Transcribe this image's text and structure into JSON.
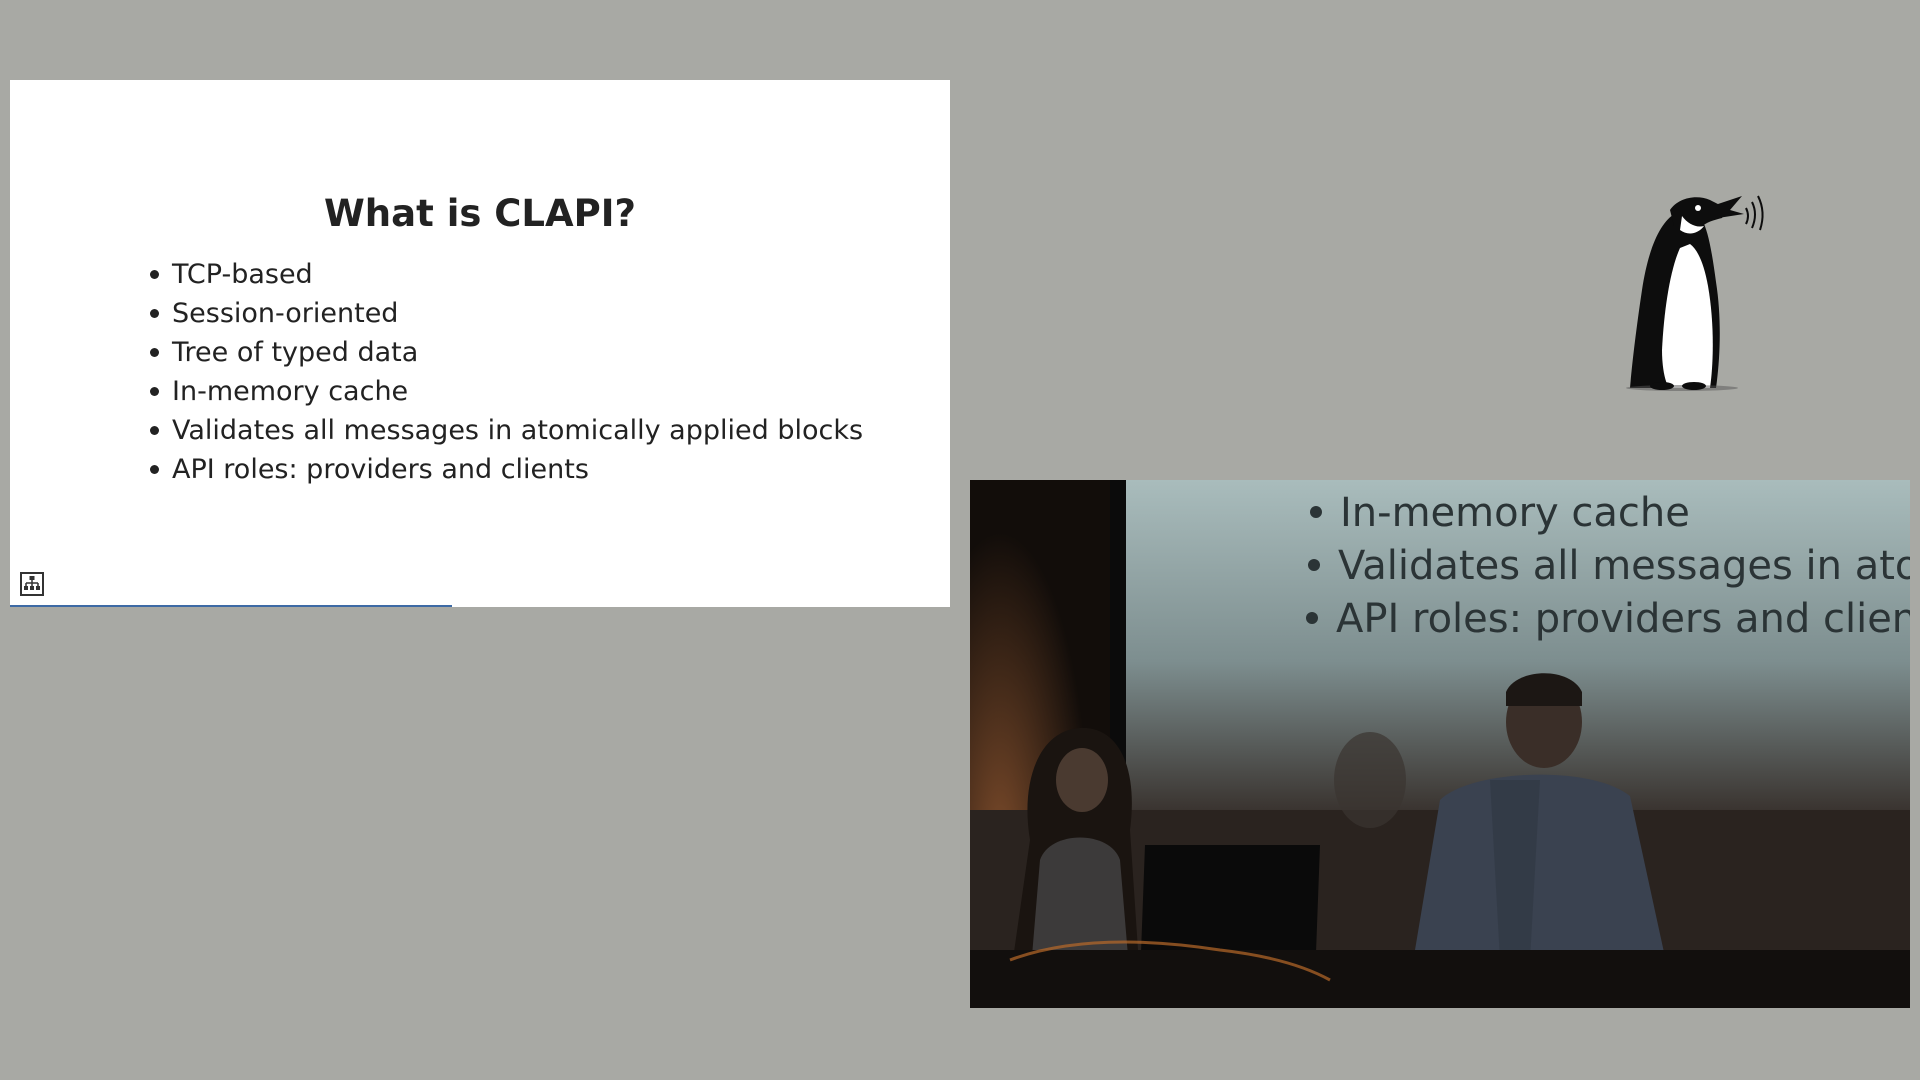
{
  "slide": {
    "title": "What is CLAPI?",
    "bullets": [
      "TCP-based",
      "Session-oriented",
      "Tree of typed data",
      "In-memory cache",
      "Validates all messages in atomically applied blocks",
      "API roles: providers and clients"
    ],
    "logo_icon": "network-tree-icon",
    "progress_fraction": 0.47
  },
  "branding": {
    "logo_icon": "penguin-icon"
  },
  "video": {
    "projected_bullets": [
      "In-memory cache",
      "Validates all messages in atomically",
      "API roles: providers and clients"
    ]
  },
  "colors": {
    "background": "#a8a9a4",
    "slide_background": "#ffffff",
    "text": "#222222",
    "progress": "#3d6aa5"
  }
}
